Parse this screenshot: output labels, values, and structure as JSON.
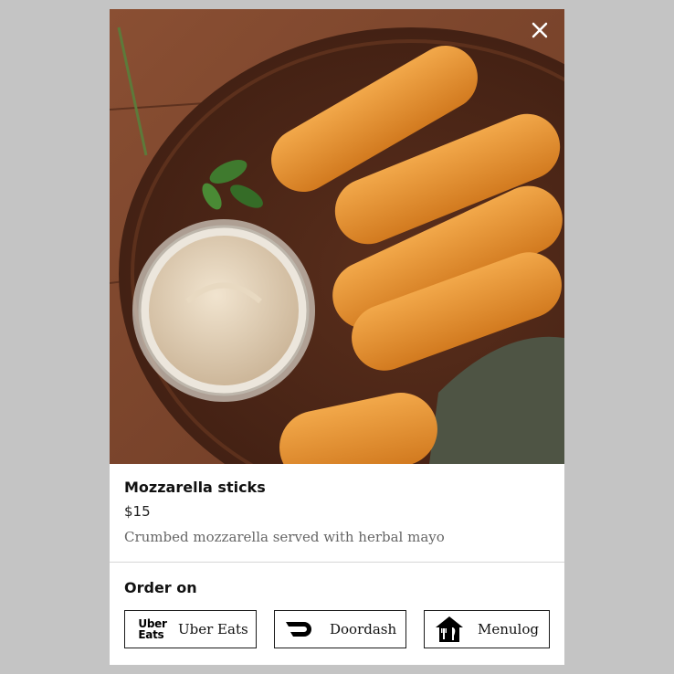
{
  "item": {
    "name": "Mozzarella sticks",
    "price": "$15",
    "description": "Crumbed mozzarella served with herbal mayo"
  },
  "order": {
    "title": "Order on",
    "platforms": [
      {
        "label": "Uber Eats",
        "icon": "uber-eats-logo",
        "logo_line1": "Uber",
        "logo_line2": "Eats"
      },
      {
        "label": "Doordash",
        "icon": "doordash-logo"
      },
      {
        "label": "Menulog",
        "icon": "menulog-logo"
      }
    ]
  },
  "icons": {
    "close": "close-icon"
  },
  "colors": {
    "overlay": "#c4c4c4",
    "modal_bg": "#ffffff",
    "border": "#1a1a1a"
  }
}
